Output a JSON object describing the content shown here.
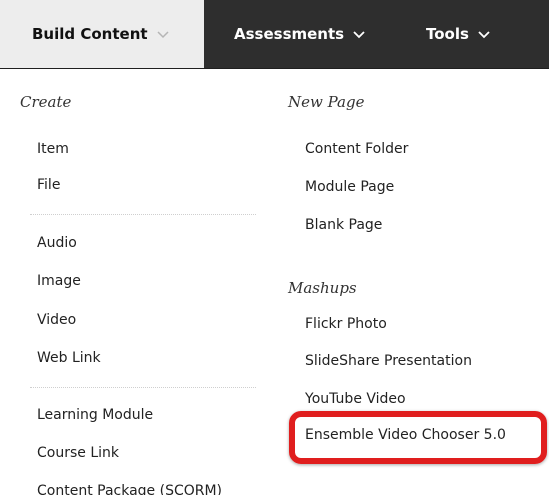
{
  "toolbar": {
    "tabs": [
      {
        "label": "Build Content",
        "active": true
      },
      {
        "label": "Assessments",
        "active": false
      },
      {
        "label": "Tools",
        "active": false
      }
    ]
  },
  "menu": {
    "left": {
      "create_heading": "Create",
      "group1": [
        "Item",
        "File"
      ],
      "group2": [
        "Audio",
        "Image",
        "Video",
        "Web Link"
      ],
      "group3": [
        "Learning Module",
        "Course Link",
        "Content Package (SCORM)"
      ]
    },
    "right": {
      "newpage_heading": "New Page",
      "newpage_items": [
        "Content Folder",
        "Module Page",
        "Blank Page"
      ],
      "mashups_heading": "Mashups",
      "mashups_items": [
        "Flickr Photo",
        "SlideShare Presentation",
        "YouTube Video",
        "Ensemble Video Chooser 5.0"
      ]
    }
  },
  "colors": {
    "toolbar_bg": "#2e2e2e",
    "active_tab_bg": "#ededed",
    "highlight": "#e01e1e"
  }
}
